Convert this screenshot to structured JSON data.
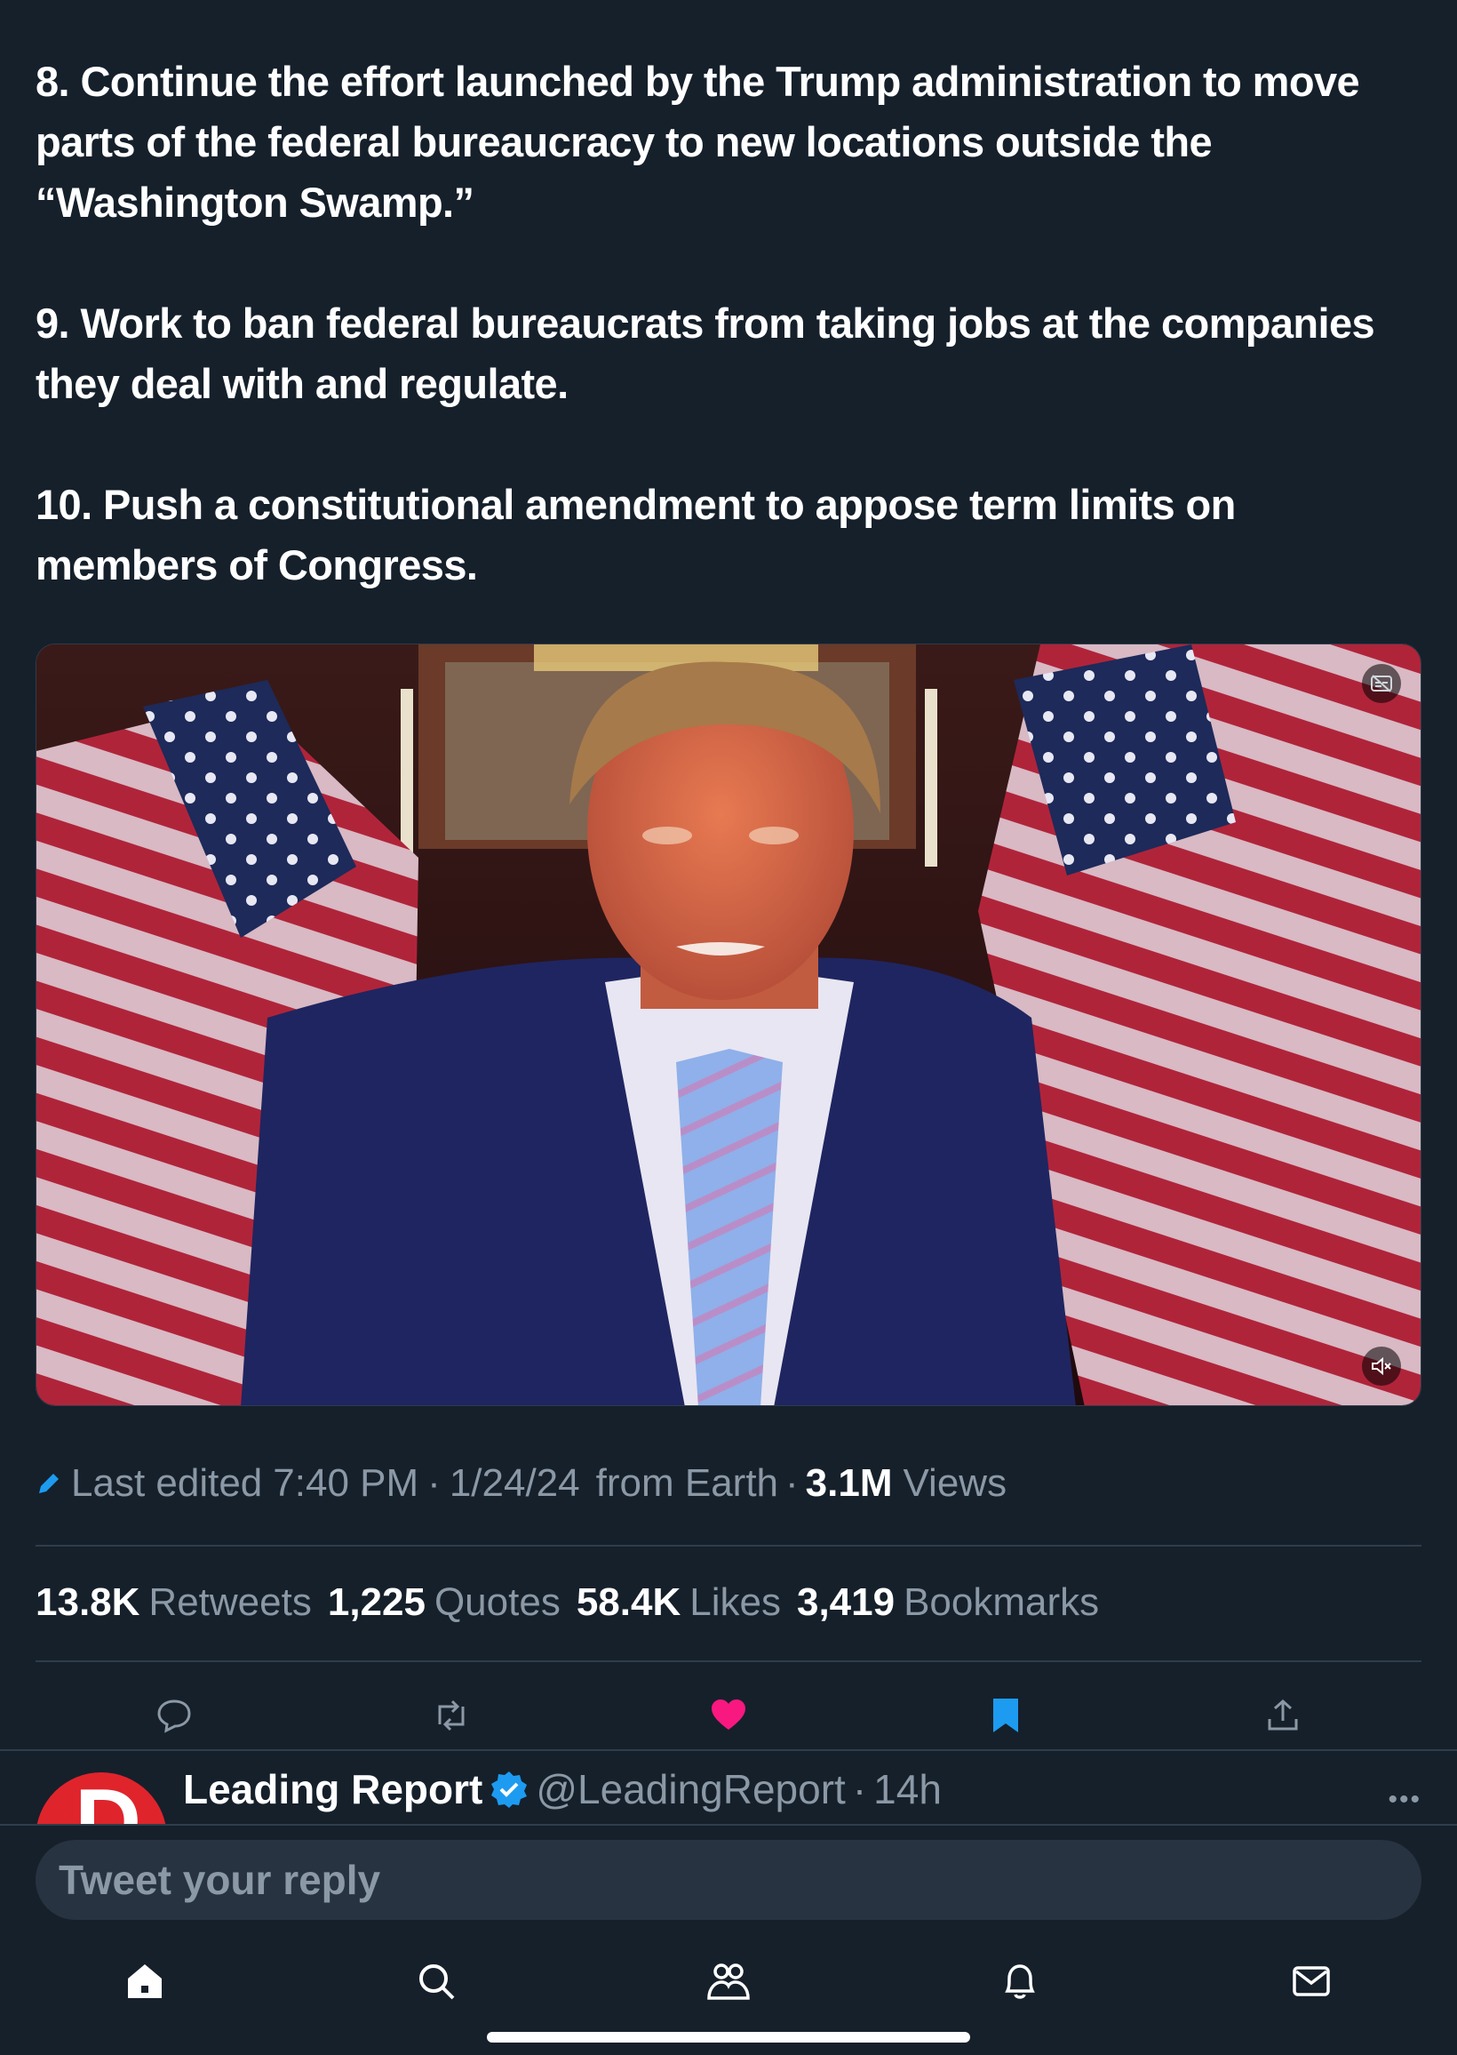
{
  "tweet": {
    "paragraphs": [
      "8. Continue the effort launched by the Trump administration to move parts of the federal bureaucracy to new locations outside the “Washington Swamp.”",
      "9. Work to ban federal bureaucrats from taking jobs at the companies they deal with and regulate.",
      "10. Push a constitutional amendment to appose term limits on members of Congress."
    ]
  },
  "video": {
    "alt": "Video still of a man in a navy suit and light blue striped tie in front of American flags",
    "icons": [
      "captions-off-icon",
      "volume-muted-icon"
    ]
  },
  "meta": {
    "edited_prefix": "Last edited",
    "time": "7:40 PM",
    "date": "1/24/24",
    "source": "from Earth",
    "views_count": "3.1M",
    "views_label": "Views",
    "separator": "·"
  },
  "stats": [
    {
      "value": "13.8K",
      "label": "Retweets"
    },
    {
      "value": "1,225",
      "label": "Quotes"
    },
    {
      "value": "58.4K",
      "label": "Likes"
    },
    {
      "value": "3,419",
      "label": "Bookmarks"
    }
  ],
  "actions": {
    "icons": [
      "reply-icon",
      "retweet-icon",
      "like-icon",
      "bookmark-icon",
      "share-icon"
    ],
    "liked": true,
    "bookmarked": true,
    "like_color": "#f91880",
    "bookmark_color": "#1d9bf0"
  },
  "next_tweet": {
    "name": "Leading Report",
    "handle": "@LeadingReport",
    "separator": "·",
    "age": "14h",
    "verified": true,
    "avatar_color": "#e0242c",
    "avatar_letter": "D"
  },
  "reply": {
    "placeholder": "Tweet your reply"
  },
  "tabbar": {
    "icons": [
      "home-icon",
      "search-icon",
      "communities-icon",
      "notifications-icon",
      "messages-icon"
    ]
  },
  "colors": {
    "background": "#15202b",
    "muted_text": "#8b98a5",
    "divider": "#2f3d4b",
    "accent": "#1d9bf0"
  }
}
